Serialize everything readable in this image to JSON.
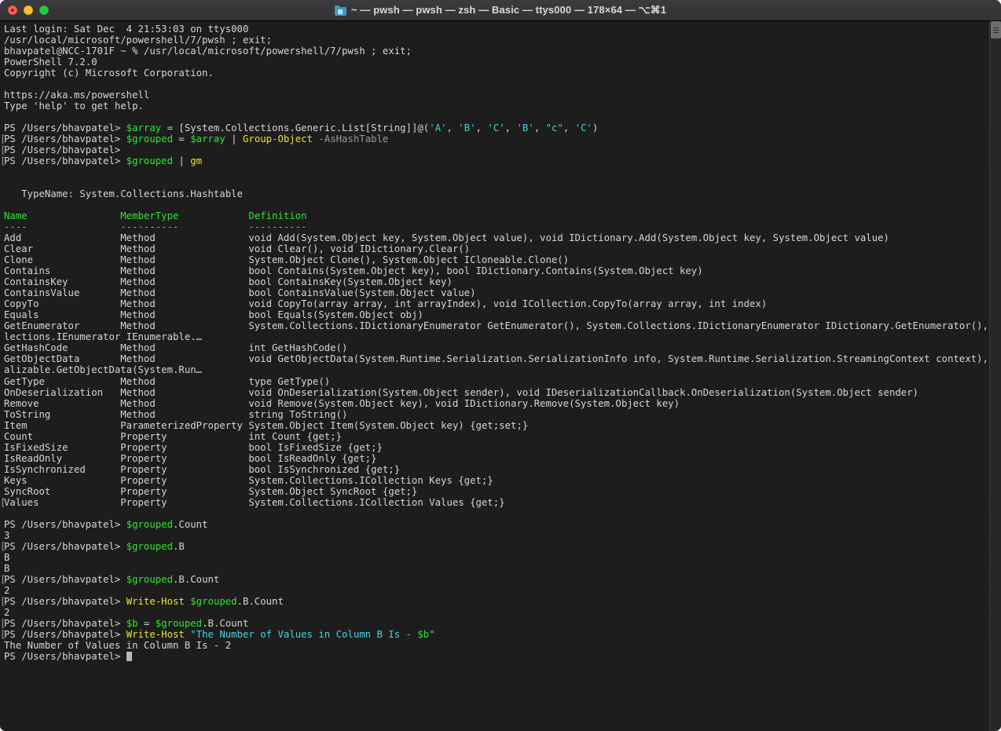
{
  "window": {
    "title": "~ — pwsh — pwsh — zsh — Basic — ttys000 — 178×64 — ⌥⌘1",
    "traffic_lights": [
      "close",
      "minimize",
      "zoom"
    ],
    "folder_icon": "folder-icon",
    "background_color": "#1d1d1d",
    "titlebar_color": "#373739"
  },
  "colors": {
    "foreground": "#d6d6d6",
    "green": "#2ee62e",
    "yellow": "#e8e337",
    "cyan": "#45d3e0",
    "gray": "#9b9b9b"
  },
  "prompt": "PS /Users/bhavpatel> ",
  "terminal": {
    "lines": [
      {
        "mark": false,
        "segs": [
          {
            "t": "Last login: Sat Dec  4 21:53:03 on ttys000",
            "c": "c-default"
          }
        ]
      },
      {
        "mark": false,
        "segs": [
          {
            "t": "/usr/local/microsoft/powershell/7/pwsh ; exit;",
            "c": "c-default"
          }
        ]
      },
      {
        "mark": false,
        "segs": [
          {
            "t": "bhavpatel@NCC-1701F ~ % /usr/local/microsoft/powershell/7/pwsh ; exit;",
            "c": "c-default"
          }
        ]
      },
      {
        "mark": false,
        "segs": [
          {
            "t": "PowerShell 7.2.0",
            "c": "c-default"
          }
        ]
      },
      {
        "mark": false,
        "segs": [
          {
            "t": "Copyright (c) Microsoft Corporation.",
            "c": "c-default"
          }
        ]
      },
      {
        "mark": false,
        "segs": [
          {
            "t": "",
            "c": "c-default"
          }
        ]
      },
      {
        "mark": false,
        "segs": [
          {
            "t": "https://aka.ms/powershell",
            "c": "c-default"
          }
        ]
      },
      {
        "mark": false,
        "segs": [
          {
            "t": "Type 'help' to get help.",
            "c": "c-default"
          }
        ]
      },
      {
        "mark": false,
        "segs": [
          {
            "t": "",
            "c": "c-default"
          }
        ]
      },
      {
        "mark": false,
        "segs": [
          {
            "t": "PS /Users/bhavpatel> ",
            "c": "c-default"
          },
          {
            "t": "$array",
            "c": "c-green"
          },
          {
            "t": " = ",
            "c": "c-default"
          },
          {
            "t": "[System.Collections.Generic.List[String]]@(",
            "c": "c-default"
          },
          {
            "t": "'A'",
            "c": "c-cyan"
          },
          {
            "t": ", ",
            "c": "c-default"
          },
          {
            "t": "'B'",
            "c": "c-cyan"
          },
          {
            "t": ", ",
            "c": "c-default"
          },
          {
            "t": "'C'",
            "c": "c-cyan"
          },
          {
            "t": ", ",
            "c": "c-default"
          },
          {
            "t": "'B'",
            "c": "c-cyan"
          },
          {
            "t": ", ",
            "c": "c-default"
          },
          {
            "t": "\"c\"",
            "c": "c-cyan"
          },
          {
            "t": ", ",
            "c": "c-default"
          },
          {
            "t": "'C'",
            "c": "c-cyan"
          },
          {
            "t": ")",
            "c": "c-default"
          }
        ]
      },
      {
        "mark": true,
        "segs": [
          {
            "t": "PS /Users/bhavpatel> ",
            "c": "c-default"
          },
          {
            "t": "$grouped",
            "c": "c-green"
          },
          {
            "t": " = ",
            "c": "c-default"
          },
          {
            "t": "$array",
            "c": "c-green"
          },
          {
            "t": " ",
            "c": "c-default"
          },
          {
            "t": "|",
            "c": "c-default"
          },
          {
            "t": " ",
            "c": "c-default"
          },
          {
            "t": "Group-Object",
            "c": "c-yellow"
          },
          {
            "t": " ",
            "c": "c-default"
          },
          {
            "t": "-AsHashTable",
            "c": "c-gray"
          }
        ]
      },
      {
        "mark": true,
        "segs": [
          {
            "t": "PS /Users/bhavpatel> ",
            "c": "c-default"
          }
        ]
      },
      {
        "mark": true,
        "segs": [
          {
            "t": "PS /Users/bhavpatel> ",
            "c": "c-default"
          },
          {
            "t": "$grouped",
            "c": "c-green"
          },
          {
            "t": " ",
            "c": "c-default"
          },
          {
            "t": "|",
            "c": "c-default"
          },
          {
            "t": " ",
            "c": "c-default"
          },
          {
            "t": "gm",
            "c": "c-yellow"
          }
        ]
      },
      {
        "mark": false,
        "segs": [
          {
            "t": "",
            "c": "c-default"
          }
        ]
      },
      {
        "mark": false,
        "segs": [
          {
            "t": "",
            "c": "c-default"
          }
        ]
      },
      {
        "mark": false,
        "segs": [
          {
            "t": "   TypeName: System.Collections.Hashtable",
            "c": "c-default"
          }
        ]
      },
      {
        "mark": false,
        "segs": [
          {
            "t": "",
            "c": "c-default"
          }
        ]
      },
      {
        "mark": false,
        "segs": [
          {
            "t": "Name                MemberType            Definition",
            "c": "c-brgreen"
          }
        ]
      },
      {
        "mark": false,
        "segs": [
          {
            "t": "----                ----------            ----------",
            "c": "c-brgreen"
          }
        ]
      },
      {
        "mark": false,
        "segs": [
          {
            "t": "Add                 Method                void Add(System.Object key, System.Object value), void IDictionary.Add(System.Object key, System.Object value)",
            "c": "c-default"
          }
        ]
      },
      {
        "mark": false,
        "segs": [
          {
            "t": "Clear               Method                void Clear(), void IDictionary.Clear()",
            "c": "c-default"
          }
        ]
      },
      {
        "mark": false,
        "segs": [
          {
            "t": "Clone               Method                System.Object Clone(), System.Object ICloneable.Clone()",
            "c": "c-default"
          }
        ]
      },
      {
        "mark": false,
        "segs": [
          {
            "t": "Contains            Method                bool Contains(System.Object key), bool IDictionary.Contains(System.Object key)",
            "c": "c-default"
          }
        ]
      },
      {
        "mark": false,
        "segs": [
          {
            "t": "ContainsKey         Method                bool ContainsKey(System.Object key)",
            "c": "c-default"
          }
        ]
      },
      {
        "mark": false,
        "segs": [
          {
            "t": "ContainsValue       Method                bool ContainsValue(System.Object value)",
            "c": "c-default"
          }
        ]
      },
      {
        "mark": false,
        "segs": [
          {
            "t": "CopyTo              Method                void CopyTo(array array, int arrayIndex), void ICollection.CopyTo(array array, int index)",
            "c": "c-default"
          }
        ]
      },
      {
        "mark": false,
        "segs": [
          {
            "t": "Equals              Method                bool Equals(System.Object obj)",
            "c": "c-default"
          }
        ]
      },
      {
        "mark": false,
        "segs": [
          {
            "t": "GetEnumerator       Method                System.Collections.IDictionaryEnumerator GetEnumerator(), System.Collections.IDictionaryEnumerator IDictionary.GetEnumerator(), System.Col",
            "c": "c-default"
          }
        ]
      },
      {
        "mark": false,
        "segs": [
          {
            "t": "lections.IEnumerator IEnumerable.…",
            "c": "c-default"
          }
        ]
      },
      {
        "mark": false,
        "segs": [
          {
            "t": "GetHashCode         Method                int GetHashCode()",
            "c": "c-default"
          }
        ]
      },
      {
        "mark": false,
        "segs": [
          {
            "t": "GetObjectData       Method                void GetObjectData(System.Runtime.Serialization.SerializationInfo info, System.Runtime.Serialization.StreamingContext context), void ISeri",
            "c": "c-default"
          }
        ]
      },
      {
        "mark": false,
        "segs": [
          {
            "t": "alizable.GetObjectData(System.Run…",
            "c": "c-default"
          }
        ]
      },
      {
        "mark": false,
        "segs": [
          {
            "t": "GetType             Method                type GetType()",
            "c": "c-default"
          }
        ]
      },
      {
        "mark": false,
        "segs": [
          {
            "t": "OnDeserialization   Method                void OnDeserialization(System.Object sender), void IDeserializationCallback.OnDeserialization(System.Object sender)",
            "c": "c-default"
          }
        ]
      },
      {
        "mark": false,
        "segs": [
          {
            "t": "Remove              Method                void Remove(System.Object key), void IDictionary.Remove(System.Object key)",
            "c": "c-default"
          }
        ]
      },
      {
        "mark": false,
        "segs": [
          {
            "t": "ToString            Method                string ToString()",
            "c": "c-default"
          }
        ]
      },
      {
        "mark": false,
        "segs": [
          {
            "t": "Item                ParameterizedProperty System.Object Item(System.Object key) {get;set;}",
            "c": "c-default"
          }
        ]
      },
      {
        "mark": false,
        "segs": [
          {
            "t": "Count               Property              int Count {get;}",
            "c": "c-default"
          }
        ]
      },
      {
        "mark": false,
        "segs": [
          {
            "t": "IsFixedSize         Property              bool IsFixedSize {get;}",
            "c": "c-default"
          }
        ]
      },
      {
        "mark": false,
        "segs": [
          {
            "t": "IsReadOnly          Property              bool IsReadOnly {get;}",
            "c": "c-default"
          }
        ]
      },
      {
        "mark": false,
        "segs": [
          {
            "t": "IsSynchronized      Property              bool IsSynchronized {get;}",
            "c": "c-default"
          }
        ]
      },
      {
        "mark": false,
        "segs": [
          {
            "t": "Keys                Property              System.Collections.ICollection Keys {get;}",
            "c": "c-default"
          }
        ]
      },
      {
        "mark": false,
        "segs": [
          {
            "t": "SyncRoot            Property              System.Object SyncRoot {get;}",
            "c": "c-default"
          }
        ]
      },
      {
        "mark": "end",
        "segs": [
          {
            "t": "Values              Property              System.Collections.ICollection Values {get;}",
            "c": "c-default"
          }
        ]
      },
      {
        "mark": false,
        "segs": [
          {
            "t": "",
            "c": "c-default"
          }
        ]
      },
      {
        "mark": false,
        "segs": [
          {
            "t": "PS /Users/bhavpatel> ",
            "c": "c-default"
          },
          {
            "t": "$grouped",
            "c": "c-green"
          },
          {
            "t": ".Count",
            "c": "c-default"
          }
        ]
      },
      {
        "mark": false,
        "segs": [
          {
            "t": "3",
            "c": "c-default"
          }
        ]
      },
      {
        "mark": true,
        "segs": [
          {
            "t": "PS /Users/bhavpatel> ",
            "c": "c-default"
          },
          {
            "t": "$grouped",
            "c": "c-green"
          },
          {
            "t": ".B",
            "c": "c-default"
          }
        ]
      },
      {
        "mark": false,
        "segs": [
          {
            "t": "B",
            "c": "c-default"
          }
        ]
      },
      {
        "mark": false,
        "segs": [
          {
            "t": "B",
            "c": "c-default"
          }
        ]
      },
      {
        "mark": true,
        "segs": [
          {
            "t": "PS /Users/bhavpatel> ",
            "c": "c-default"
          },
          {
            "t": "$grouped",
            "c": "c-green"
          },
          {
            "t": ".B.Count",
            "c": "c-default"
          }
        ]
      },
      {
        "mark": false,
        "segs": [
          {
            "t": "2",
            "c": "c-default"
          }
        ]
      },
      {
        "mark": true,
        "segs": [
          {
            "t": "PS /Users/bhavpatel> ",
            "c": "c-default"
          },
          {
            "t": "Write-Host",
            "c": "c-yellow"
          },
          {
            "t": " ",
            "c": "c-default"
          },
          {
            "t": "$grouped",
            "c": "c-green"
          },
          {
            "t": ".B.Count",
            "c": "c-default"
          }
        ]
      },
      {
        "mark": false,
        "segs": [
          {
            "t": "2",
            "c": "c-default"
          }
        ]
      },
      {
        "mark": true,
        "segs": [
          {
            "t": "PS /Users/bhavpatel> ",
            "c": "c-default"
          },
          {
            "t": "$b",
            "c": "c-green"
          },
          {
            "t": " = ",
            "c": "c-default"
          },
          {
            "t": "$grouped",
            "c": "c-green"
          },
          {
            "t": ".B.Count",
            "c": "c-default"
          }
        ]
      },
      {
        "mark": true,
        "segs": [
          {
            "t": "PS /Users/bhavpatel> ",
            "c": "c-default"
          },
          {
            "t": "Write-Host",
            "c": "c-yellow"
          },
          {
            "t": " ",
            "c": "c-default"
          },
          {
            "t": "\"The Number of Values in Column B Is - ",
            "c": "c-cyan"
          },
          {
            "t": "$b",
            "c": "c-green"
          },
          {
            "t": "\"",
            "c": "c-cyan"
          }
        ]
      },
      {
        "mark": false,
        "segs": [
          {
            "t": "The Number of Values in Column B Is - 2",
            "c": "c-default"
          }
        ]
      },
      {
        "mark": false,
        "cursor": true,
        "segs": [
          {
            "t": "PS /Users/bhavpatel> ",
            "c": "c-default"
          }
        ]
      }
    ]
  }
}
